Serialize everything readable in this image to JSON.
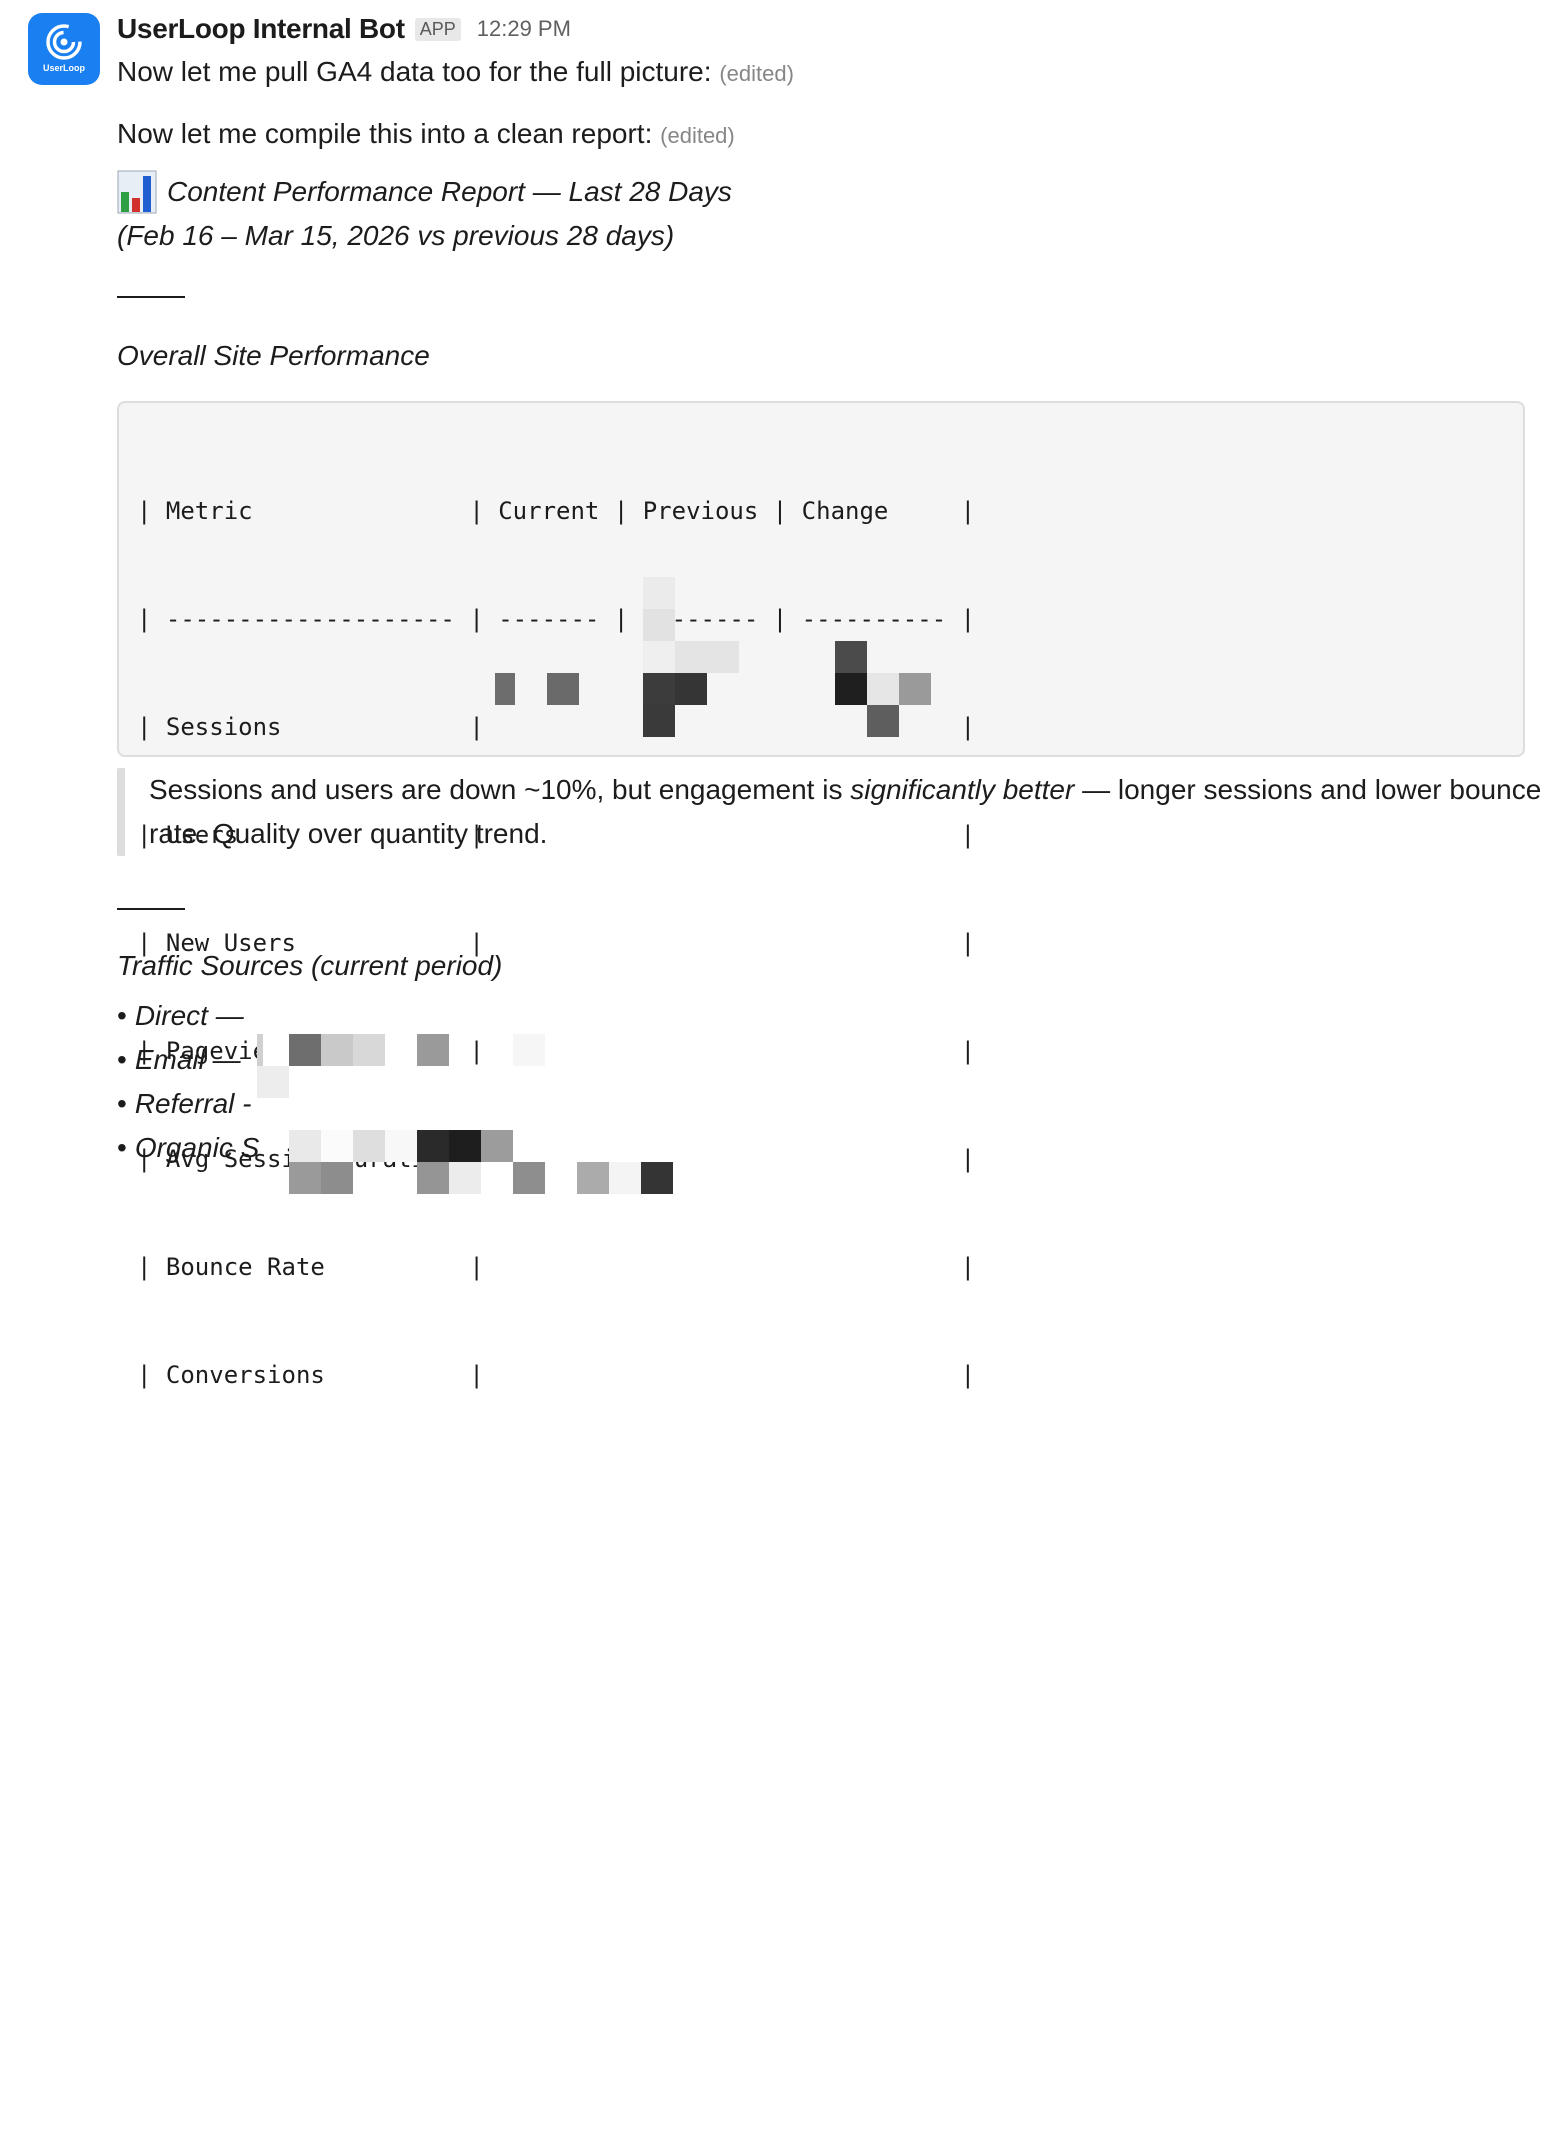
{
  "bot": {
    "name": "UserLoop Internal Bot",
    "badge": "APP",
    "time": "12:29 PM",
    "avatar_label": "UserLoop"
  },
  "messages": [
    {
      "text": "Now let me pull GA4 data too for the full picture:",
      "edited": "(edited)"
    },
    {
      "text": "Now let me compile this into a clean report:",
      "edited": "(edited)"
    }
  ],
  "report": {
    "icon": "bar-chart-icon",
    "title": "Content Performance Report — Last 28 Days",
    "subtitle": "(Feb 16 – Mar 15, 2026 vs previous 28 days)"
  },
  "overall": {
    "heading": "Overall Site Performance",
    "table_lines": [
      "| Metric               | Current | Previous | Change     |",
      "| -------------------- | ------- | -------- | ---------- |",
      "| Sessions             |                                 |",
      "| Users                |                                 |",
      "| New Users            |                                 |",
      "| Pageviews            |                                 |",
      "| Avg Session Duration |                                 |",
      "| Bounce Rate          |                                 |",
      "| Conversions          |                                 |"
    ],
    "quote_before": "Sessions and users are down ~10%, but engagement is ",
    "quote_em": "significantly better",
    "quote_after": " — longer sessions and lower bounce rate. Quality over quantity trend."
  },
  "traffic": {
    "heading": "Traffic Sources (current period)",
    "items": [
      {
        "label": "Direct —"
      },
      {
        "label": "Email —"
      },
      {
        "label": "Referral -"
      },
      {
        "label": "Organic S"
      }
    ]
  },
  "colors": {
    "accent": "#1a7ff0",
    "text": "#1d1c1d",
    "muted": "#868686"
  }
}
